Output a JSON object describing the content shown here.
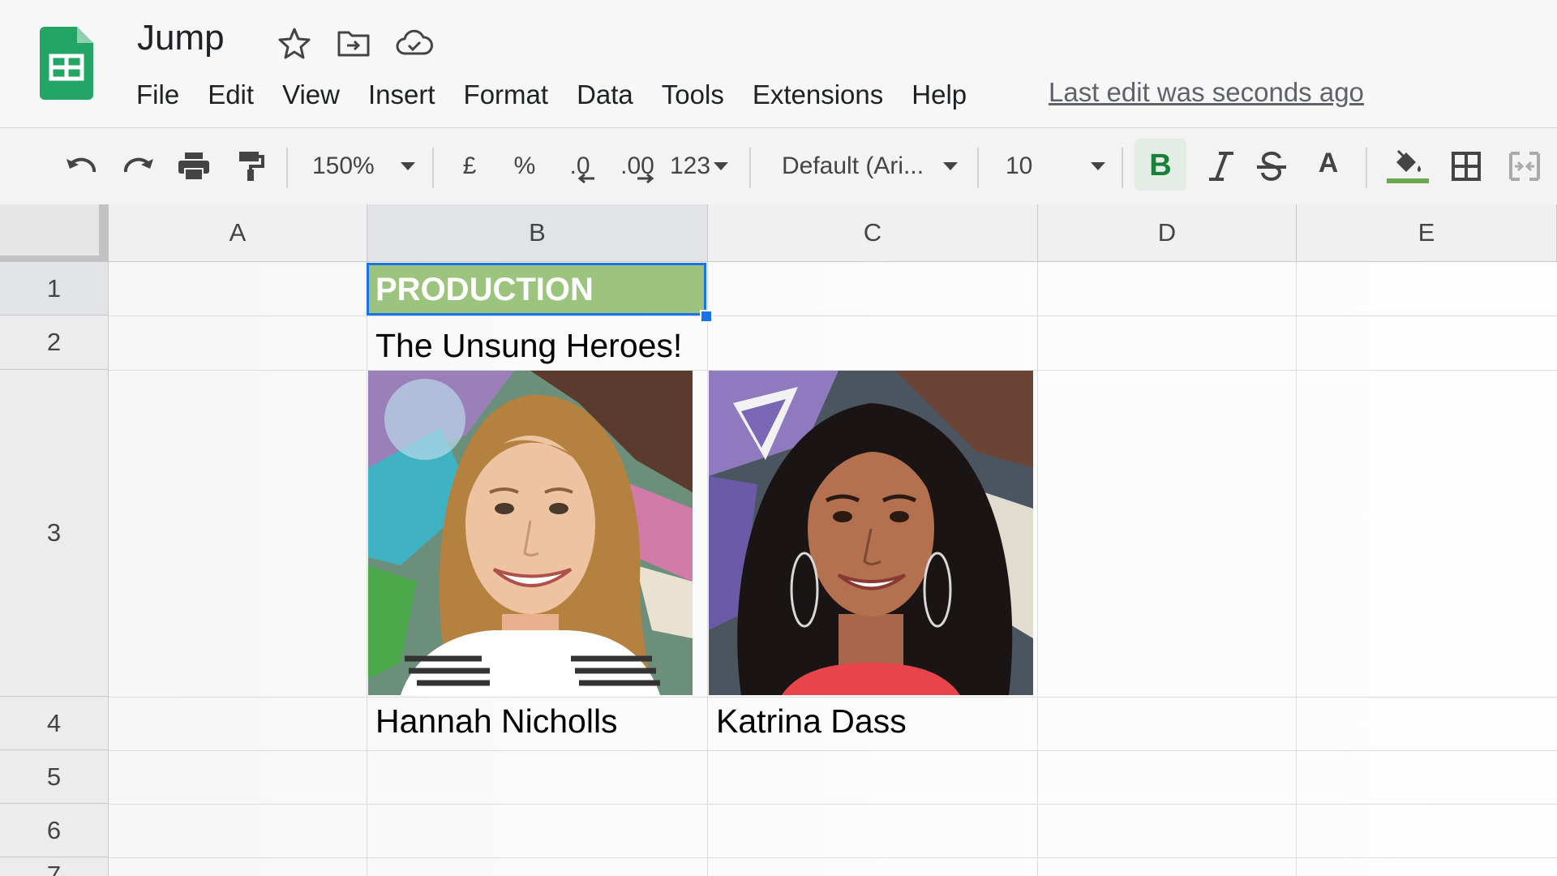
{
  "document": {
    "title": "Jump"
  },
  "title_icons": [
    "star-icon",
    "move-to-folder-icon",
    "cloud-saved-icon"
  ],
  "menu": [
    "File",
    "Edit",
    "View",
    "Insert",
    "Format",
    "Data",
    "Tools",
    "Extensions",
    "Help"
  ],
  "last_edit": "Last edit was seconds ago",
  "toolbar": {
    "zoom": "150%",
    "currency": "£",
    "percent": "%",
    "decrease_decimal": ".0",
    "increase_decimal": ".00",
    "more_formats": "123",
    "font": "Default (Ari...",
    "font_size": "10",
    "text_color_label": "A",
    "icons": [
      "undo-icon",
      "redo-icon",
      "print-icon",
      "paint-format-icon",
      "bold-icon",
      "italic-icon",
      "strikethrough-icon",
      "text-color-icon",
      "fill-color-icon",
      "borders-icon",
      "merge-cells-icon"
    ]
  },
  "columns": [
    "A",
    "B",
    "C",
    "D",
    "E"
  ],
  "rows": [
    "1",
    "2",
    "3",
    "4",
    "5",
    "6",
    "7"
  ],
  "cells": {
    "B1": "PRODUCTION",
    "B2": "The Unsung Heroes!",
    "B4": "Hannah Nicholls",
    "C4": "Katrina Dass"
  },
  "colors": {
    "header_fill": "#9cc47e",
    "selection": "#1a73e8",
    "sheets_green": "#23a566",
    "fill_color_bar": "#6aa84f"
  }
}
